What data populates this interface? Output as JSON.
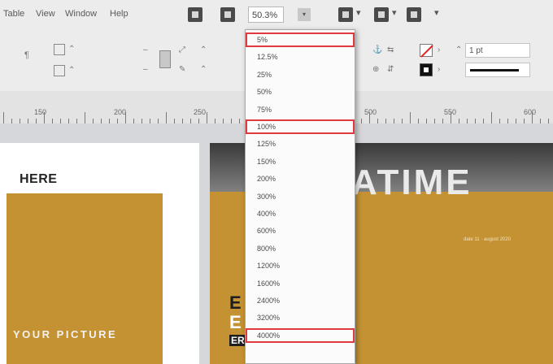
{
  "menu": {
    "items": [
      "Table",
      "View",
      "Window",
      "Help"
    ]
  },
  "toolbar": {
    "zoom_value": "50.3%",
    "zoom_dd_arrow": "▾",
    "view_dd_arrow": "▾",
    "screen_dd_arrow": "▾",
    "arrange_dd_arrow": "▾"
  },
  "control_panel": {
    "stroke_weight": "1 pt",
    "spin_symbol": "⌃"
  },
  "ruler": {
    "labels": [
      "150",
      "200",
      "250",
      "500",
      "550",
      "600"
    ]
  },
  "document": {
    "headline": "HERE",
    "picture_label": "YOUR PICTURE",
    "big_title": "ATIME",
    "date_label": "date 11 · august 2020",
    "edge_text_1": "E",
    "edge_text_2": "E",
    "edge_text_3": "ER"
  },
  "zoom_menu": {
    "options": [
      {
        "label": "5%",
        "highlighted": true
      },
      {
        "label": "12.5%",
        "highlighted": false
      },
      {
        "label": "25%",
        "highlighted": false
      },
      {
        "label": "50%",
        "highlighted": false
      },
      {
        "label": "75%",
        "highlighted": false
      },
      {
        "label": "100%",
        "highlighted": true
      },
      {
        "label": "125%",
        "highlighted": false
      },
      {
        "label": "150%",
        "highlighted": false
      },
      {
        "label": "200%",
        "highlighted": false
      },
      {
        "label": "300%",
        "highlighted": false
      },
      {
        "label": "400%",
        "highlighted": false
      },
      {
        "label": "600%",
        "highlighted": false
      },
      {
        "label": "800%",
        "highlighted": false
      },
      {
        "label": "1200%",
        "highlighted": false
      },
      {
        "label": "1600%",
        "highlighted": false
      },
      {
        "label": "2400%",
        "highlighted": false
      },
      {
        "label": "3200%",
        "highlighted": false
      },
      {
        "label": "4000%",
        "highlighted": true
      }
    ]
  },
  "colors": {
    "highlight": "#e03a3f",
    "gold": "#c49232"
  }
}
